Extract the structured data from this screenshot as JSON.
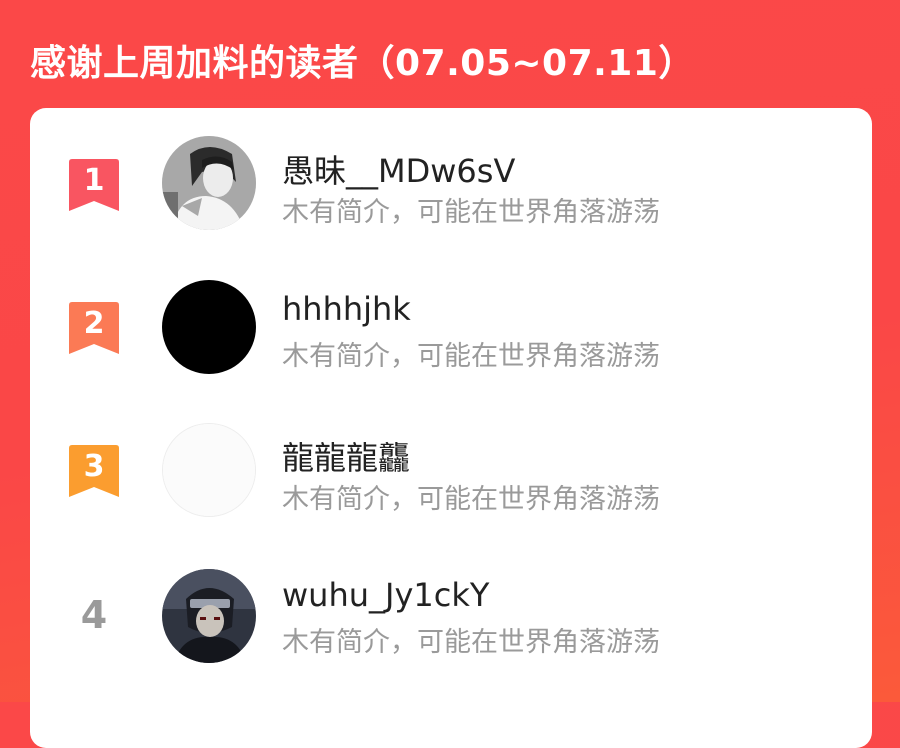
{
  "header": {
    "title": "感谢上周加料的读者（07.05~07.11）"
  },
  "colors": {
    "background": "#fa4747",
    "rank1": "#f95561",
    "rank2": "#fb7a55",
    "rank3": "#fb9d2f",
    "plain_rank": "#9a9a9a",
    "bio_text": "#9a9a9a"
  },
  "readers": [
    {
      "rank": "1",
      "username": "愚昧__MDw6sV",
      "bio": "木有简介，可能在世界角落游荡",
      "avatar": "anime-boy-avatar"
    },
    {
      "rank": "2",
      "username": "hhhhjhk",
      "bio": "木有简介，可能在世界角落游荡",
      "avatar": "black-avatar"
    },
    {
      "rank": "3",
      "username": "龍龍龍龘",
      "bio": "木有简介，可能在世界角落游荡",
      "avatar": "blank-avatar"
    },
    {
      "rank": "4",
      "username": "wuhu_Jy1ckY",
      "bio": "木有简介，可能在世界角落游荡",
      "avatar": "ninja-avatar"
    }
  ]
}
